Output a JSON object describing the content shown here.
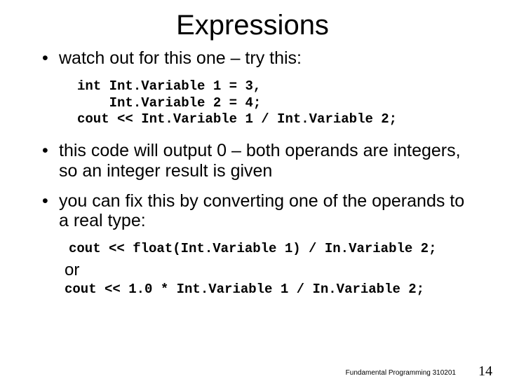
{
  "title": "Expressions",
  "bullets": [
    "watch out for this one – try this:",
    "this code will output 0 – both operands are integers, so an integer result is given",
    "you can fix this by converting one of the operands to a real type:"
  ],
  "code1": "int Int.Variable 1 = 3,\n    Int.Variable 2 = 4;\ncout << Int.Variable 1 / Int.Variable 2;",
  "or_label": "or",
  "code2a": "cout << float(Int.Variable 1) / In.Variable 2;",
  "code2b": "cout << 1.0 * Int.Variable 1 / In.Variable 2;",
  "footer": "Fundamental Programming 310201",
  "page_num": "14"
}
